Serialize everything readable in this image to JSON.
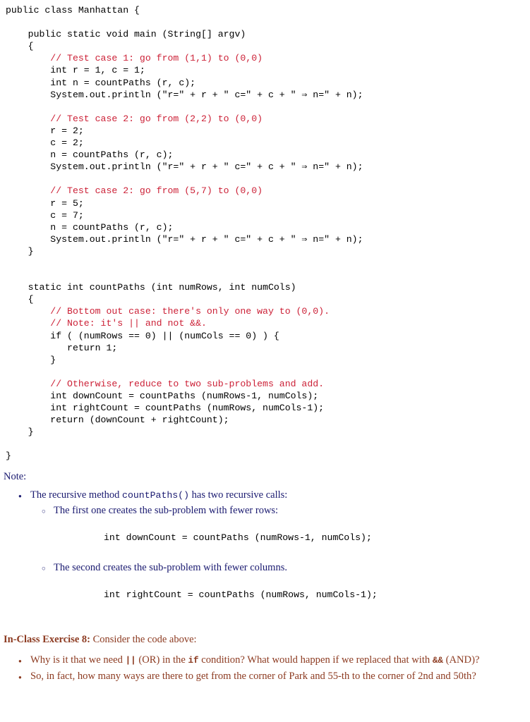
{
  "document": {
    "colors": {
      "background": "#ffffff",
      "code_text": "#000000",
      "code_comment": "#cc2137",
      "note_text": "#1a1a70",
      "exercise_text": "#8c3a20"
    }
  },
  "code": {
    "lines": [
      {
        "text": "public class Manhattan {",
        "kind": "code"
      },
      {
        "text": "",
        "kind": "blank"
      },
      {
        "text": "    public static void main (String[] argv)",
        "kind": "code"
      },
      {
        "text": "    {",
        "kind": "code"
      },
      {
        "text": "        // Test case 1: go from (1,1) to (0,0)",
        "kind": "comment"
      },
      {
        "text": "        int r = 1, c = 1;",
        "kind": "code"
      },
      {
        "text": "        int n = countPaths (r, c);",
        "kind": "code"
      },
      {
        "text": "        System.out.println (\"r=\" + r + \" c=\" + c + \" ⇒ n=\" + n);",
        "kind": "code"
      },
      {
        "text": "",
        "kind": "blank"
      },
      {
        "text": "        // Test case 2: go from (2,2) to (0,0)",
        "kind": "comment"
      },
      {
        "text": "        r = 2;",
        "kind": "code"
      },
      {
        "text": "        c = 2;",
        "kind": "code"
      },
      {
        "text": "        n = countPaths (r, c);",
        "kind": "code"
      },
      {
        "text": "        System.out.println (\"r=\" + r + \" c=\" + c + \" ⇒ n=\" + n);",
        "kind": "code"
      },
      {
        "text": "",
        "kind": "blank"
      },
      {
        "text": "        // Test case 2: go from (5,7) to (0,0)",
        "kind": "comment"
      },
      {
        "text": "        r = 5;",
        "kind": "code"
      },
      {
        "text": "        c = 7;",
        "kind": "code"
      },
      {
        "text": "        n = countPaths (r, c);",
        "kind": "code"
      },
      {
        "text": "        System.out.println (\"r=\" + r + \" c=\" + c + \" ⇒ n=\" + n);",
        "kind": "code"
      },
      {
        "text": "    }",
        "kind": "code"
      },
      {
        "text": "",
        "kind": "blank"
      },
      {
        "text": "",
        "kind": "blank"
      },
      {
        "text": "    static int countPaths (int numRows, int numCols)",
        "kind": "code"
      },
      {
        "text": "    {",
        "kind": "code"
      },
      {
        "text": "        // Bottom out case: there's only one way to (0,0).",
        "kind": "comment"
      },
      {
        "text": "        // Note: it's || and not &&.",
        "kind": "comment"
      },
      {
        "text": "        if ( (numRows == 0) || (numCols == 0) ) {",
        "kind": "code"
      },
      {
        "text": "           return 1;",
        "kind": "code"
      },
      {
        "text": "        }",
        "kind": "code"
      },
      {
        "text": "",
        "kind": "blank"
      },
      {
        "text": "        // Otherwise, reduce to two sub-problems and add.",
        "kind": "comment"
      },
      {
        "text": "        int downCount = countPaths (numRows-1, numCols);",
        "kind": "code"
      },
      {
        "text": "        int rightCount = countPaths (numRows, numCols-1);",
        "kind": "code"
      },
      {
        "text": "        return (downCount + rightCount);",
        "kind": "code"
      },
      {
        "text": "    }",
        "kind": "code"
      },
      {
        "text": "",
        "kind": "blank"
      },
      {
        "text": "}",
        "kind": "code"
      }
    ]
  },
  "note": {
    "heading": "Note:",
    "bullet_main": {
      "pre": "The recursive method ",
      "mono": "countPaths()",
      "post": " has two recursive calls:"
    },
    "sub_one": {
      "text": "The first one creates the sub-problem with fewer rows:",
      "snippet": "int downCount = countPaths (numRows-1, numCols);"
    },
    "sub_two": {
      "text": "The second creates the sub-problem with fewer columns.",
      "snippet": "int rightCount = countPaths (numRows, numCols-1);"
    }
  },
  "exercise": {
    "label": "In-Class Exercise 8:",
    "intro": " Consider the code above:",
    "question_one": {
      "part_a": "Why is it that we need ",
      "mono_a": "||",
      "part_b": " (OR) in the ",
      "mono_b": "if",
      "part_c": " condition? What would happen if we replaced that with ",
      "mono_c": "&&",
      "part_d": " (AND)?"
    },
    "question_two": "So, in fact, how many ways are there to get from the corner of Park and 55-th to the corner of 2nd and 50th?"
  }
}
